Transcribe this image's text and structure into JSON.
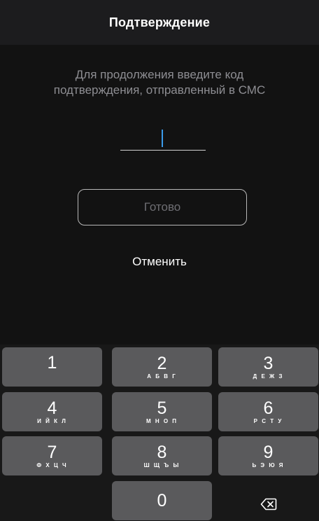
{
  "navbar": {
    "title": "Подтверждение"
  },
  "verification": {
    "instruction_line1": "Для продолжения введите код",
    "instruction_line2": "подтверждения, отправленный в СМС",
    "code_value": "",
    "done_label": "Готово",
    "cancel_label": "Отменить"
  },
  "keypad": {
    "keys": [
      {
        "digit": "1",
        "letters": ""
      },
      {
        "digit": "2",
        "letters": "А Б В Г"
      },
      {
        "digit": "3",
        "letters": "Д Е Ж З"
      },
      {
        "digit": "4",
        "letters": "И Й К Л"
      },
      {
        "digit": "5",
        "letters": "М Н О П"
      },
      {
        "digit": "6",
        "letters": "Р С Т У"
      },
      {
        "digit": "7",
        "letters": "Ф Х Ц Ч"
      },
      {
        "digit": "8",
        "letters": "Ш Щ Ъ Ы"
      },
      {
        "digit": "9",
        "letters": "Ь Э Ю Я"
      },
      {
        "digit": "0",
        "letters": ""
      }
    ],
    "delete_icon": "backspace-icon"
  },
  "colors": {
    "background": "#121212",
    "navbar": "#1c1c1e",
    "key": "#5a5a5c",
    "cursor": "#3b9bea",
    "muted_text": "#8e8e93"
  }
}
